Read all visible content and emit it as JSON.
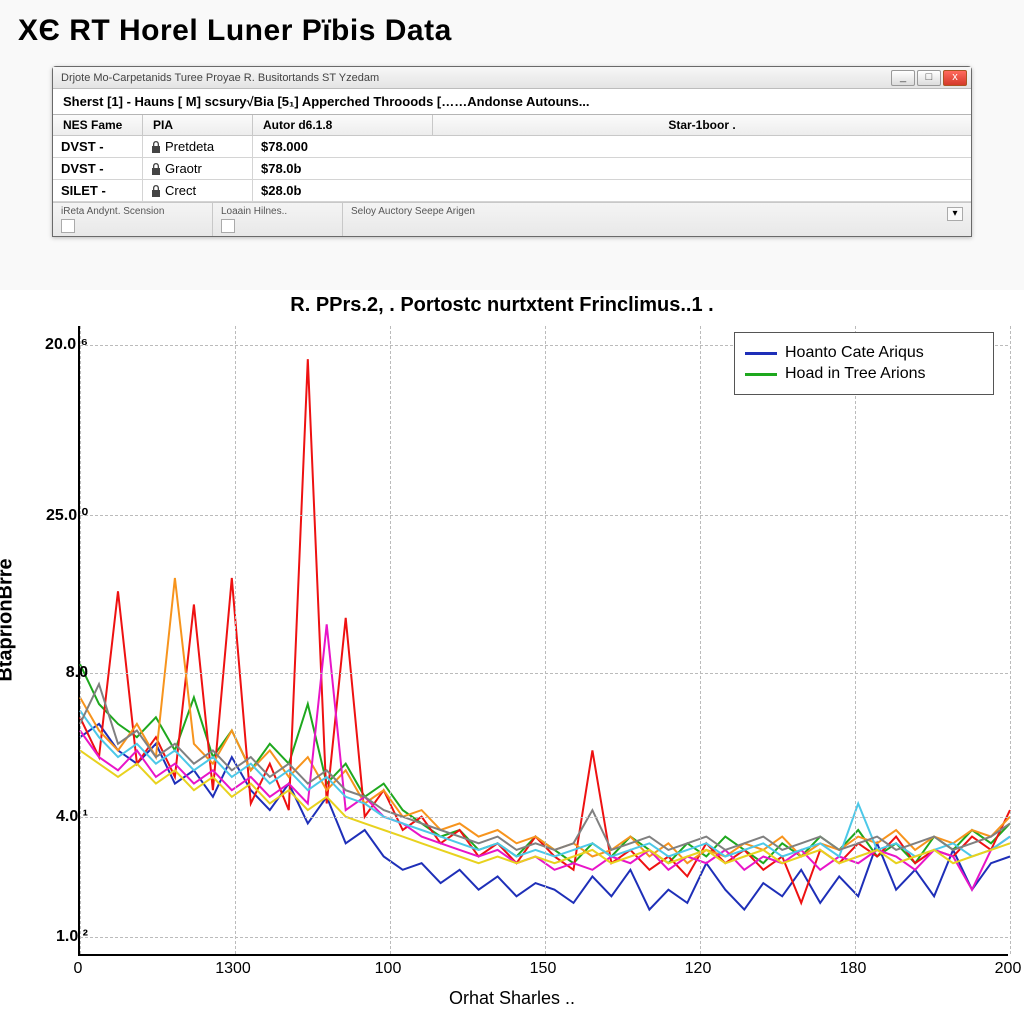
{
  "page_heading": "XЄ RT Horel Luner Pïbis Data",
  "window": {
    "title": "Drjote Mo-Carpetanids Turee Proyae R. Busitortands ST Yzedam",
    "buttons": {
      "min": "_",
      "max": "□",
      "close": "x"
    },
    "menu": [
      "Sherst  [1] - Hauns  [ M]   scsury√Bia   [5₁]   Apperched  Throoods   [……Andonse Autouns..."
    ],
    "columns": {
      "c1": "NES Fame",
      "c2": "PIA",
      "c3": "Autor d6.1.8",
      "c4": "Star-1boor ."
    },
    "rows": [
      {
        "name": "DVST  -",
        "pia": "Pretdeta",
        "val": "$78.000"
      },
      {
        "name": "DVST  -",
        "pia": "Graotr",
        "val": "$78.0b"
      },
      {
        "name": "SILET -",
        "pia": "Crect",
        "val": "$28.0b"
      }
    ],
    "panels": [
      "iReta  Andynt. Scension",
      "Loaain Hilnes..",
      "Seloy Auctory Seepe Arigen"
    ]
  },
  "chart_data": {
    "type": "line",
    "title": "R. PPrs.2, . Portostc nurtxtent Frinclimus..1 .",
    "xlabel": "Orhat Sharles ..",
    "ylabel": "BtaprionBrre",
    "x_ticks": [
      0,
      1300,
      100,
      150,
      120,
      180,
      200
    ],
    "y_ticks_labels": [
      "20.0 ⁶",
      "25.0 ⁰",
      "8.0",
      "4.0 ¹",
      "1.0 ²"
    ],
    "y_tick_positions_frac": [
      0.03,
      0.3,
      0.55,
      0.78,
      0.97
    ],
    "legend": [
      {
        "name": "Hoanto Cate Ariqus",
        "color": "#1e2fb8"
      },
      {
        "name": "Hoad in Tree Arions",
        "color": "#1ea81e"
      }
    ],
    "series": [
      {
        "name": "blue",
        "color": "#1e2fb8",
        "values": [
          7.6,
          8.0,
          7.2,
          6.8,
          7.4,
          6.2,
          6.6,
          5.8,
          7.0,
          6.0,
          5.4,
          6.2,
          5.0,
          5.8,
          4.4,
          4.8,
          4.0,
          3.6,
          3.8,
          3.2,
          3.6,
          3.0,
          3.4,
          2.8,
          3.2,
          3.0,
          2.6,
          3.4,
          2.8,
          3.6,
          2.4,
          3.0,
          2.6,
          3.8,
          3.0,
          2.4,
          3.2,
          2.8,
          3.6,
          2.6,
          3.4,
          2.8,
          4.4,
          3.0,
          3.6,
          2.8,
          4.2,
          3.0,
          3.8,
          4.0
        ]
      },
      {
        "name": "green",
        "color": "#1ea81e",
        "values": [
          9.8,
          8.6,
          8.0,
          7.6,
          8.2,
          7.2,
          8.8,
          7.0,
          7.8,
          6.6,
          7.4,
          6.8,
          8.6,
          6.2,
          6.8,
          5.8,
          6.2,
          5.4,
          5.0,
          4.6,
          4.8,
          4.2,
          4.4,
          4.0,
          4.6,
          4.2,
          3.8,
          4.4,
          4.0,
          4.6,
          4.2,
          3.8,
          4.4,
          4.0,
          4.6,
          4.2,
          3.8,
          4.4,
          4.0,
          4.6,
          4.2,
          4.8,
          4.0,
          4.4,
          3.8,
          4.6,
          4.2,
          4.8,
          4.4,
          5.0
        ]
      },
      {
        "name": "red",
        "color": "#e11",
        "values": [
          8.2,
          7.0,
          12.0,
          6.8,
          7.6,
          6.4,
          11.6,
          6.0,
          12.4,
          5.6,
          6.8,
          5.4,
          19.0,
          5.6,
          11.2,
          5.2,
          6.0,
          4.8,
          5.2,
          4.4,
          4.8,
          4.0,
          4.4,
          3.8,
          4.6,
          4.0,
          3.6,
          7.2,
          3.8,
          4.2,
          3.6,
          4.0,
          3.4,
          4.4,
          3.8,
          4.2,
          3.6,
          4.0,
          2.6,
          4.2,
          3.8,
          4.4,
          4.0,
          4.6,
          3.8,
          4.2,
          4.0,
          4.6,
          4.2,
          5.4
        ]
      },
      {
        "name": "orange",
        "color": "#f7941d",
        "values": [
          8.8,
          7.8,
          7.2,
          8.0,
          7.0,
          12.4,
          7.4,
          6.8,
          7.8,
          6.6,
          7.2,
          6.4,
          7.0,
          6.0,
          6.6,
          5.6,
          6.0,
          5.2,
          5.4,
          4.8,
          5.0,
          4.6,
          4.8,
          4.4,
          4.6,
          4.2,
          4.4,
          4.0,
          4.2,
          4.6,
          4.0,
          4.4,
          3.8,
          4.2,
          4.0,
          4.4,
          4.2,
          4.6,
          4.0,
          4.4,
          4.2,
          4.6,
          4.4,
          4.8,
          4.2,
          4.6,
          4.4,
          4.8,
          4.6,
          5.2
        ]
      },
      {
        "name": "magenta",
        "color": "#e815c8",
        "values": [
          7.8,
          7.0,
          6.6,
          7.2,
          6.4,
          6.8,
          6.2,
          6.6,
          6.0,
          6.4,
          5.8,
          6.2,
          5.6,
          11.0,
          5.4,
          5.8,
          5.2,
          5.0,
          4.6,
          4.4,
          4.2,
          4.0,
          4.2,
          3.8,
          4.0,
          3.6,
          3.8,
          3.6,
          4.0,
          3.8,
          4.2,
          3.6,
          4.0,
          3.8,
          4.2,
          3.6,
          4.0,
          3.8,
          4.2,
          3.6,
          4.0,
          3.8,
          4.2,
          4.0,
          3.6,
          4.2,
          4.0,
          3.0,
          4.2,
          4.6
        ]
      },
      {
        "name": "cyan",
        "color": "#4cc8e8",
        "values": [
          8.4,
          7.6,
          7.0,
          7.4,
          6.8,
          7.2,
          6.6,
          7.0,
          6.4,
          6.8,
          6.2,
          6.6,
          6.0,
          6.4,
          5.8,
          5.6,
          5.2,
          5.0,
          4.8,
          4.6,
          4.4,
          4.2,
          4.4,
          4.0,
          4.2,
          4.0,
          4.2,
          4.4,
          4.0,
          4.2,
          4.4,
          4.0,
          4.2,
          4.4,
          4.0,
          4.2,
          4.4,
          4.0,
          4.2,
          4.4,
          4.0,
          5.6,
          4.2,
          4.4,
          4.0,
          4.2,
          4.4,
          4.0,
          4.2,
          4.6
        ]
      },
      {
        "name": "gray",
        "color": "#808080",
        "values": [
          8.0,
          9.2,
          7.4,
          7.8,
          7.0,
          7.4,
          6.8,
          7.2,
          6.6,
          7.0,
          6.4,
          6.8,
          6.2,
          6.6,
          6.0,
          5.8,
          5.4,
          5.2,
          5.0,
          4.8,
          4.6,
          4.4,
          4.6,
          4.2,
          4.4,
          4.2,
          4.4,
          5.4,
          4.2,
          4.4,
          4.6,
          4.2,
          4.4,
          4.6,
          4.2,
          4.4,
          4.6,
          4.2,
          4.4,
          4.6,
          4.2,
          4.4,
          4.6,
          4.2,
          4.4,
          4.6,
          4.2,
          4.4,
          4.6,
          5.0
        ]
      },
      {
        "name": "yellow",
        "color": "#e8d21e",
        "values": [
          7.2,
          6.8,
          6.4,
          6.8,
          6.2,
          6.6,
          6.0,
          6.4,
          5.8,
          6.2,
          5.6,
          6.0,
          5.4,
          5.8,
          5.2,
          5.0,
          4.8,
          4.6,
          4.4,
          4.2,
          4.0,
          3.8,
          4.0,
          3.8,
          4.0,
          3.8,
          4.0,
          4.2,
          3.8,
          4.0,
          4.2,
          3.8,
          4.0,
          4.2,
          3.8,
          4.0,
          4.2,
          3.8,
          4.0,
          4.2,
          3.8,
          4.0,
          4.2,
          3.8,
          4.0,
          4.2,
          3.8,
          4.0,
          4.2,
          4.4
        ]
      }
    ],
    "yrange": [
      1.0,
      20.0
    ]
  }
}
